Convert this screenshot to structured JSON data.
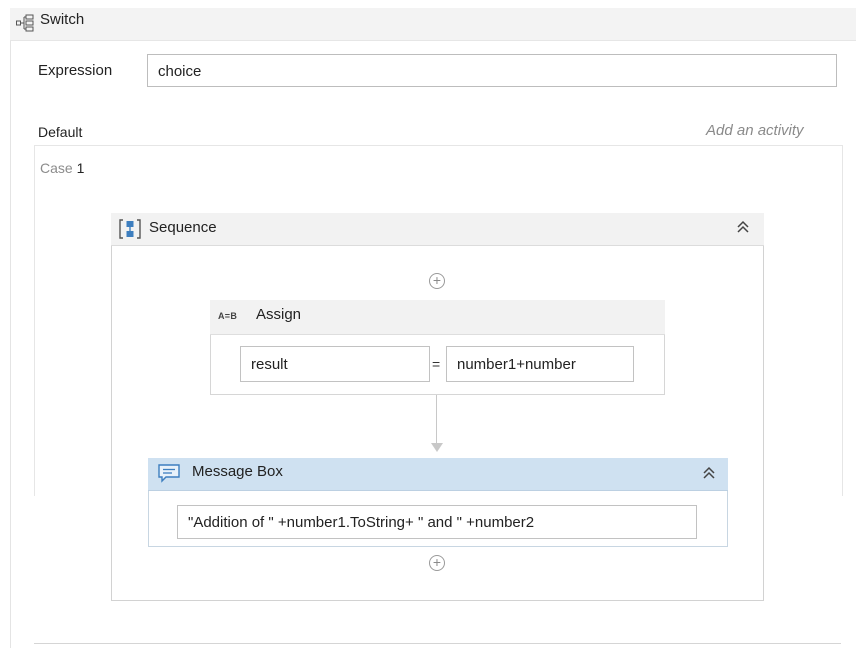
{
  "switch": {
    "title": "Switch",
    "expression_label": "Expression",
    "expression_value": "choice",
    "default_label": "Default",
    "add_activity": "Add an activity",
    "case_label": "Case",
    "case_value": "1"
  },
  "sequence": {
    "title": "Sequence"
  },
  "assign": {
    "icon_text": "A=B",
    "title": "Assign",
    "left": "result",
    "equals": "=",
    "right": "number1+number"
  },
  "message_box": {
    "title": "Message Box",
    "text": "\"Addition of \" +number1.ToString+ \" and \"  +number2"
  },
  "colors": {
    "message_box_header": "#cfe1f1",
    "header_gray": "#f2f2f2"
  }
}
